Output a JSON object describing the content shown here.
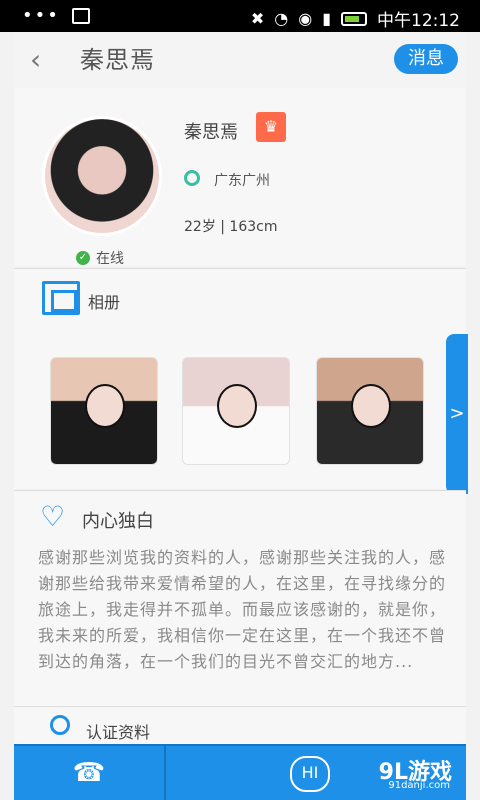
{
  "status_bar": {
    "time": "中午12:12",
    "left_icons": [
      "notification-dots",
      "image-icon"
    ],
    "right_icons": [
      "mute-icon",
      "wifi-icon",
      "alarm-icon",
      "signal-icon",
      "battery-icon"
    ]
  },
  "header": {
    "title": "秦思焉",
    "action_label": "消息",
    "back_icon": "chevron-left-icon"
  },
  "profile": {
    "name": "秦思焉",
    "vip_icon": "crown-icon",
    "location": "广东广州",
    "age_height": "22岁 | 163cm",
    "online_status": "在线",
    "accent_color": "#1e90e8"
  },
  "album": {
    "title": "相册",
    "photos": [
      "photo-1",
      "photo-2",
      "photo-3"
    ],
    "more_icon": ">"
  },
  "intro": {
    "title": "内心独白",
    "text": "感谢那些浏览我的资料的人，感谢那些关注我的人，感谢那些给我带来爱情希望的人，在这里，在寻找缘分的旅途上，我走得并不孤单。而最应该感谢的，就是你，我未来的所爱，我相信你一定在这里，在一个我还不曾到达的角落，在一个我们的目光不曾交汇的地方..."
  },
  "auth": {
    "title": "认证资料"
  },
  "bottom_bar": {
    "call_icon": "phone-icon",
    "hi_label": "HI",
    "watermark": "9L游戏",
    "watermark_sub": "91danji.com"
  }
}
